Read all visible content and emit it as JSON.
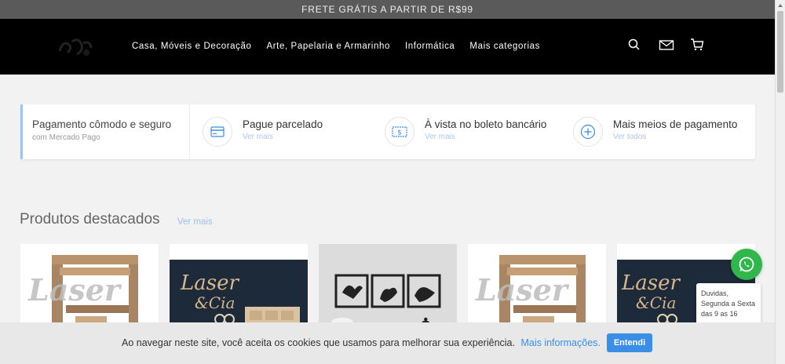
{
  "announcement": "FRETE GRÁTIS A PARTIR DE R$99",
  "nav": [
    {
      "label": "Casa, Móveis e Decoração"
    },
    {
      "label": "Arte, Papelaria e Armarinho"
    },
    {
      "label": "Informática"
    },
    {
      "label": "Mais categorias"
    }
  ],
  "header_icons": [
    "search-icon",
    "mail-icon",
    "cart-icon"
  ],
  "payment": {
    "title": "Pagamento cômodo e seguro",
    "subtitle": "com Mercado Pago",
    "items": [
      {
        "title": "Pague parcelado",
        "link": "Ver mais",
        "icon": "credit-card-icon"
      },
      {
        "title": "À vista no boleto bancário",
        "link": "Ver mais",
        "icon": "boleto-icon"
      },
      {
        "title": "Mais meios de pagamento",
        "link": "Ver todos",
        "icon": "plus-circle-icon"
      }
    ]
  },
  "featured": {
    "title": "Produtos destacados",
    "link": "Ver mais",
    "products": [
      {
        "image": "laser-engraver-image"
      },
      {
        "image": "laser-cia-sign-image"
      },
      {
        "image": "bird-frames-image"
      },
      {
        "image": "laser-engraver-image"
      },
      {
        "image": "laser-cia-sign-image"
      }
    ]
  },
  "whatsapp": {
    "tooltip": "Duvidas, Segunda a Sexta das 9 as 16"
  },
  "cookie": {
    "message": "Ao navegar neste site, você aceita os cookies que usamos para melhorar sua experiência.",
    "more": "Mais informações.",
    "button": "Entendi"
  },
  "colors": {
    "accent": "#3a8ee6",
    "header": "#000000",
    "topbar": "#5a5a5a",
    "whatsapp": "#30b64a"
  }
}
